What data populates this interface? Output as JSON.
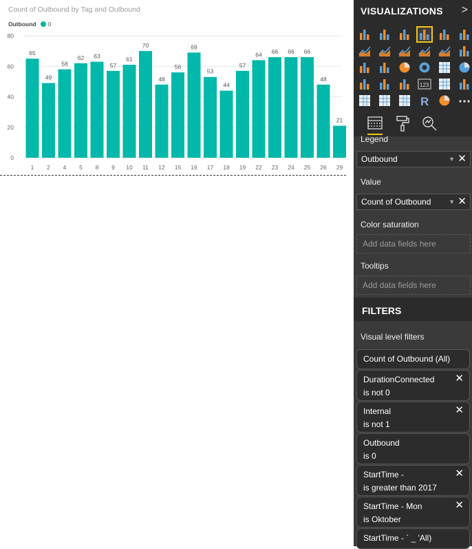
{
  "chart": {
    "title": "Count of Outbound by Tag and Outbound",
    "legend_title": "Outbound",
    "legend_item": "0",
    "color": "#01b8aa"
  },
  "chart_data": {
    "type": "bar",
    "title": "Count of Outbound by Tag and Outbound",
    "categories": [
      "1",
      "2",
      "4",
      "5",
      "8",
      "9",
      "10",
      "11",
      "12",
      "15",
      "16",
      "17",
      "18",
      "19",
      "22",
      "23",
      "24",
      "25",
      "26",
      "29"
    ],
    "series": [
      {
        "name": "0",
        "values": [
          65,
          49,
          58,
          62,
          63,
          57,
          61,
          70,
          48,
          56,
          69,
          53,
          44,
          57,
          64,
          66,
          66,
          66,
          48,
          21
        ]
      }
    ],
    "ylim": [
      0,
      80
    ],
    "yticks": [
      "0",
      "20",
      "40",
      "60",
      "80"
    ],
    "grid": true,
    "legend_position": "top-left"
  },
  "viz": {
    "title": "VISUALIZATIONS",
    "chevron": ">",
    "icons": [
      "stacked-bar-icon",
      "stacked-column-icon",
      "clustered-bar-icon",
      "clustered-column-icon",
      "100-bar-icon",
      "100-column-icon",
      "line-icon",
      "area-icon",
      "stacked-area-icon",
      "line-column-icon",
      "line-clustered-column-icon",
      "ribbon-icon",
      "waterfall-icon",
      "scatter-icon",
      "pie-icon",
      "donut-icon",
      "treemap-icon",
      "map-icon",
      "filled-map-icon",
      "funnel-icon",
      "gauge-icon",
      "card-icon",
      "multirow-card-icon",
      "kpi-icon",
      "slicer-icon",
      "table-icon",
      "matrix-icon",
      "r-visual-icon",
      "globe-icon",
      "more-icon"
    ],
    "selected_index": 3,
    "tabs": [
      "fields-icon",
      "format-paint-icon",
      "analytics-icon"
    ]
  },
  "wells": {
    "legend_label": "Legend",
    "legend_field": "Outbound",
    "value_label": "Value",
    "value_field": "Count of Outbound",
    "color_sat_label": "Color saturation",
    "color_sat_placeholder": "Add data fields here",
    "tooltips_label": "Tooltips",
    "tooltips_placeholder": "Add data fields here"
  },
  "filters": {
    "title": "FILTERS",
    "visual_level": "Visual level filters",
    "items": [
      {
        "title": "Count of Outbound  (All)",
        "sub": ""
      },
      {
        "title": "DurationConnected",
        "sub": "is not 0"
      },
      {
        "title": "Internal",
        "sub": "is not 1"
      },
      {
        "title": "Outbound",
        "sub": "is 0"
      },
      {
        "title": "StartTime -",
        "sub": "is greater than 2017"
      },
      {
        "title": "StartTime - Mon",
        "sub": "is Oktober"
      },
      {
        "title": "StartTime - `  _  'All)",
        "sub": ""
      }
    ]
  }
}
